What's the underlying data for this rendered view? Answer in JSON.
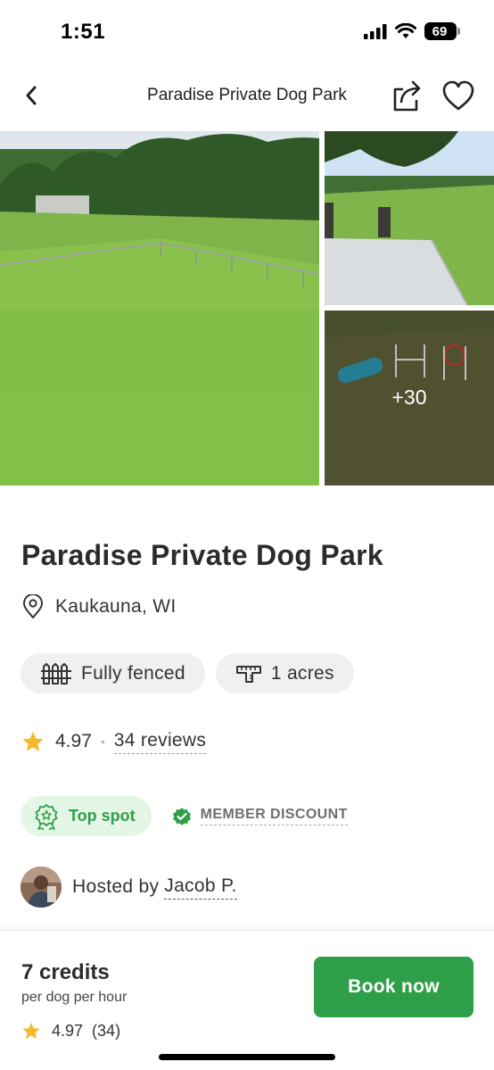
{
  "status_bar": {
    "time": "1:51",
    "battery": "69"
  },
  "nav": {
    "title": "Paradise Private Dog Park"
  },
  "gallery": {
    "more_count": "+30"
  },
  "park": {
    "name": "Paradise Private Dog Park",
    "location": "Kaukauna, WI",
    "features": [
      {
        "icon": "fence-icon",
        "label": "Fully fenced"
      },
      {
        "icon": "ruler-icon",
        "label": "1 acres"
      }
    ],
    "rating": "4.97",
    "reviews": "34 reviews",
    "badges": {
      "top_spot": "Top spot",
      "member_discount": "MEMBER DISCOUNT"
    },
    "host": {
      "prefix": "Hosted by",
      "name": "Jacob P."
    }
  },
  "booking": {
    "price": "7 credits",
    "unit": "per dog per hour",
    "rating": "4.97",
    "review_count": "(34)",
    "button_label": "Book now"
  },
  "colors": {
    "accent": "#2f9e48",
    "star": "#f5b92e",
    "badge_bg": "#e4f7e6"
  }
}
